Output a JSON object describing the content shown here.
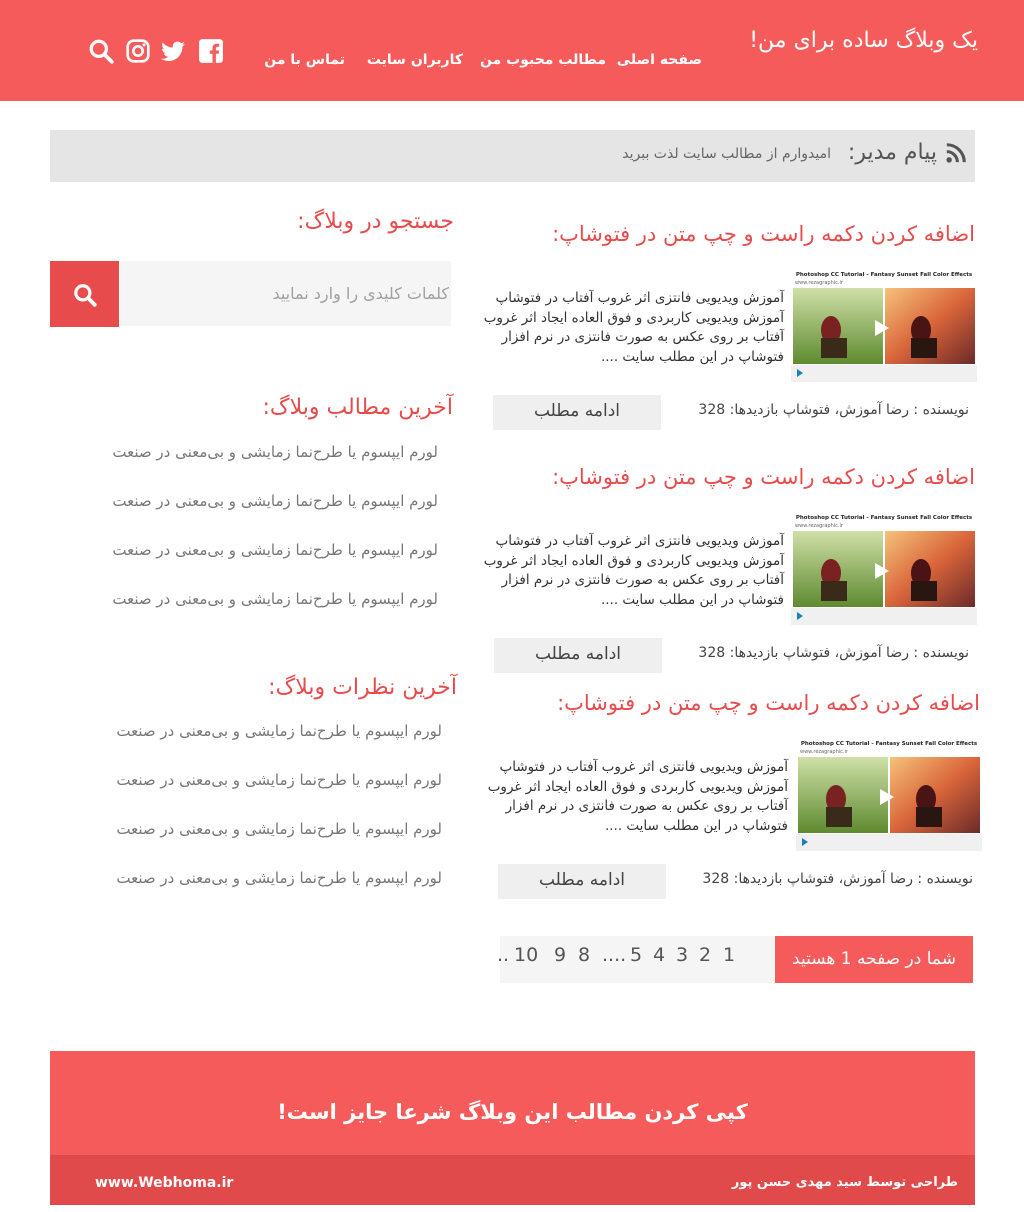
{
  "header": {
    "site_title": "یک وبلاگ ساده برای من!",
    "nav": [
      "صفحه اصلی",
      "مطالب محبوب من",
      "کاربران سایت",
      "تماس با من"
    ],
    "icons": [
      "facebook-icon",
      "twitter-icon",
      "instagram-icon",
      "search-icon"
    ]
  },
  "admin": {
    "label": "پیام مدیر:",
    "text": "امیدوارم از مطالب سایت لذت ببرید"
  },
  "posts": [
    {
      "title": "اضافه کردن دکمه راست و چپ متن در فتوشاپ:",
      "excerpt": "آموزش ویدیویی فانتزی اثر غروب آفتاب در فتوشاپ آموزش ویدیویی کاربردی و فوق العاده ایجاد اثر غروب آفتاب بر روی عکس به صورت فانتزی در نرم افزار فتوشاپ در این مطلب سایت ....",
      "meta": "نویسنده : رضا آموزش، فتوشاپ بازدیدها: 328",
      "more": "ادامه مطلب"
    },
    {
      "title": "اضافه کردن دکمه راست و چپ متن در فتوشاپ:",
      "excerpt": "آموزش ویدیویی فانتزی اثر غروب آفتاب در فتوشاپ آموزش ویدیویی کاربردی و فوق العاده ایجاد اثر غروب آفتاب بر روی عکس به صورت فانتزی در نرم افزار فتوشاپ در این مطلب سایت ....",
      "meta": "نویسنده : رضا آموزش، فتوشاپ بازدیدها: 328",
      "more": "ادامه مطلب"
    },
    {
      "title": "اضافه کردن دکمه راست و چپ متن در فتوشاپ:",
      "excerpt": "آموزش ویدیویی فانتزی اثر غروب آفتاب در فتوشاپ آموزش ویدیویی کاربردی و فوق العاده ایجاد اثر غروب آفتاب بر روی عکس به صورت فانتزی در نرم افزار فتوشاپ در این مطلب سایت ....",
      "meta": "نویسنده : رضا آموزش، فتوشاپ بازدیدها: 328",
      "more": "ادامه مطلب"
    }
  ],
  "thumb": {
    "caption": "Photoshop CC Tutorial - Fantasy Sunset Fall Color Effects",
    "site": "www.rezagraphic.ir"
  },
  "pagination": {
    "current_label": "شما در صفحه 1 هستید",
    "pages": [
      "1",
      "2",
      "3",
      "4",
      "5",
      "....",
      "8",
      "9",
      "10",
      ".."
    ]
  },
  "sidebar": {
    "search_title": "جستجو در وبلاگ:",
    "search_placeholder": "کلمات کلیدی را وارد نمایید",
    "latest_title": "آخرین مطالب وبلاگ:",
    "latest_items": [
      "لورم ایپسوم یا طرح‌نما زمایشی و بی‌معنی در صنعت",
      "لورم ایپسوم یا طرح‌نما زمایشی و بی‌معنی در صنعت",
      "لورم ایپسوم یا طرح‌نما زمایشی و بی‌معنی در صنعت",
      "لورم ایپسوم یا طرح‌نما زمایشی و بی‌معنی در صنعت"
    ],
    "comments_title": "آخرین نظرات وبلاگ:",
    "comment_items": [
      "لورم ایپسوم یا طرح‌نما زمایشی و بی‌معنی در صنعت",
      "لورم ایپسوم یا طرح‌نما زمایشی و بی‌معنی در صنعت",
      "لورم ایپسوم یا طرح‌نما زمایشی و بی‌معنی در صنعت",
      "لورم ایپسوم یا طرح‌نما زمایشی و بی‌معنی در صنعت"
    ]
  },
  "footer": {
    "copy_text": "کپی کردن مطالب این وبلاگ شرعا جایز است!",
    "credit": "طراحی توسط سید مهدی حسن پور",
    "domain": "www.Webhoma.ir"
  },
  "colors": {
    "primary": "#f65b5b",
    "accent_dark": "#e84b4b",
    "footer_bottom": "#e14a4a"
  }
}
